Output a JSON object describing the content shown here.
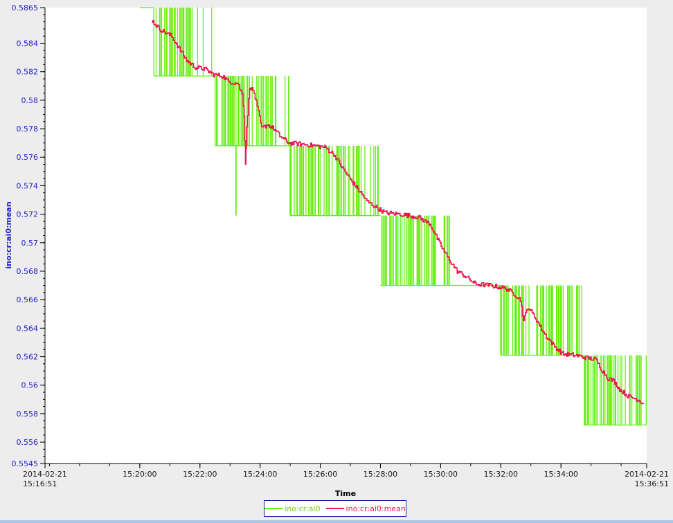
{
  "chart_data": {
    "type": "line",
    "title": "",
    "xlabel": "Time",
    "ylabel": "ino:cr:ai0:mean",
    "ylim": [
      0.5545,
      0.5865
    ],
    "yticks": [
      "0.5545",
      "0.556",
      "0.558",
      "0.56",
      "0.562",
      "0.564",
      "0.566",
      "0.568",
      "0.57",
      "0.572",
      "0.574",
      "0.576",
      "0.578",
      "0.58",
      "0.582",
      "0.584",
      "0.5865"
    ],
    "xrange_minutes": [
      0,
      20
    ],
    "xticks": [
      {
        "t": 0,
        "line1": "2014-02-21",
        "line2": "15:16:51",
        "edge": "start"
      },
      {
        "t": 3.15,
        "line1": "15:20:00"
      },
      {
        "t": 5.15,
        "line1": "15:22:00"
      },
      {
        "t": 7.15,
        "line1": "15:24:00"
      },
      {
        "t": 9.15,
        "line1": "15:26:00"
      },
      {
        "t": 11.15,
        "line1": "15:28:00"
      },
      {
        "t": 13.15,
        "line1": "15:30:00"
      },
      {
        "t": 15.15,
        "line1": "15:32:00"
      },
      {
        "t": 17.15,
        "line1": "15:34:00"
      },
      {
        "t": 20,
        "line1": "2014-02-21",
        "line2": "15:36:51",
        "edge": "end"
      }
    ],
    "series": [
      {
        "name": "ino:cr:ai0",
        "color": "#66ee11",
        "segments": [
          {
            "t0": 3.15,
            "t1": 3.6,
            "low": 0.5865,
            "high": 0.5865,
            "dense": false
          },
          {
            "t0": 3.6,
            "t1": 5.65,
            "low": 0.5817,
            "high": 0.5865,
            "dense": true
          },
          {
            "t0": 5.65,
            "t1": 8.15,
            "low": 0.5768,
            "high": 0.5817,
            "dense": true
          },
          {
            "t0": 8.15,
            "t1": 11.15,
            "low": 0.5719,
            "high": 0.5768,
            "dense": true
          },
          {
            "t0": 11.15,
            "t1": 13.5,
            "low": 0.567,
            "high": 0.5719,
            "dense": true
          },
          {
            "t0": 13.5,
            "t1": 15.15,
            "low": 0.567,
            "high": 0.567,
            "dense": false
          },
          {
            "t0": 15.15,
            "t1": 16.5,
            "low": 0.5621,
            "high": 0.567,
            "dense": true
          },
          {
            "t0": 16.5,
            "t1": 17.9,
            "low": 0.5621,
            "high": 0.567,
            "dense": true
          },
          {
            "t0": 17.9,
            "t1": 20,
            "low": 0.5572,
            "high": 0.5621,
            "dense": true
          }
        ],
        "outliers": [
          {
            "t": 6.35,
            "low": 0.5719,
            "high": 0.5768
          },
          {
            "t": 8.15,
            "low": 0.5719,
            "high": 0.5768
          },
          {
            "t": 9.1,
            "low": 0.5719,
            "high": 0.5768
          },
          {
            "t": 6.0,
            "low": 0.5768,
            "high": 0.5817
          },
          {
            "t": 8.1,
            "low": 0.5768,
            "high": 0.5817
          },
          {
            "t": 12.4,
            "low": 0.567,
            "high": 0.5719
          },
          {
            "t": 15.15,
            "low": 0.5621,
            "high": 0.567
          },
          {
            "t": 18.05,
            "low": 0.5572,
            "high": 0.5621
          }
        ]
      },
      {
        "name": "ino:cr:ai0:mean",
        "color": "#e8194e",
        "points": [
          [
            3.55,
            0.5856
          ],
          [
            3.8,
            0.585
          ],
          [
            4.2,
            0.5845
          ],
          [
            4.5,
            0.5835
          ],
          [
            4.7,
            0.5828
          ],
          [
            5.0,
            0.5823
          ],
          [
            5.3,
            0.5822
          ],
          [
            5.6,
            0.5818
          ],
          [
            5.9,
            0.5817
          ],
          [
            6.1,
            0.5813
          ],
          [
            6.4,
            0.5812
          ],
          [
            6.55,
            0.5804
          ],
          [
            6.62,
            0.579
          ],
          [
            6.66,
            0.5755
          ],
          [
            6.7,
            0.578
          ],
          [
            6.8,
            0.581
          ],
          [
            6.95,
            0.5805
          ],
          [
            7.05,
            0.5795
          ],
          [
            7.2,
            0.578
          ],
          [
            7.4,
            0.5783
          ],
          [
            7.6,
            0.578
          ],
          [
            7.8,
            0.5775
          ],
          [
            8.1,
            0.577
          ],
          [
            8.6,
            0.5769
          ],
          [
            9.0,
            0.5768
          ],
          [
            9.3,
            0.5767
          ],
          [
            9.6,
            0.5762
          ],
          [
            9.9,
            0.5752
          ],
          [
            10.2,
            0.5743
          ],
          [
            10.5,
            0.5735
          ],
          [
            10.7,
            0.5729
          ],
          [
            11.0,
            0.5725
          ],
          [
            11.3,
            0.5721
          ],
          [
            11.8,
            0.572
          ],
          [
            12.4,
            0.5718
          ],
          [
            12.8,
            0.5713
          ],
          [
            13.1,
            0.57
          ],
          [
            13.4,
            0.5689
          ],
          [
            13.7,
            0.568
          ],
          [
            14.0,
            0.5676
          ],
          [
            14.3,
            0.5671
          ],
          [
            14.8,
            0.567
          ],
          [
            15.3,
            0.5668
          ],
          [
            15.6,
            0.5664
          ],
          [
            15.8,
            0.566
          ],
          [
            15.9,
            0.5645
          ],
          [
            16.05,
            0.5655
          ],
          [
            16.3,
            0.5647
          ],
          [
            16.6,
            0.5636
          ],
          [
            16.9,
            0.5628
          ],
          [
            17.2,
            0.5622
          ],
          [
            17.6,
            0.5621
          ],
          [
            18.05,
            0.5619
          ],
          [
            18.3,
            0.5618
          ],
          [
            18.5,
            0.5611
          ],
          [
            18.7,
            0.5605
          ],
          [
            18.9,
            0.5603
          ],
          [
            19.1,
            0.5597
          ],
          [
            19.4,
            0.5592
          ],
          [
            19.7,
            0.559
          ],
          [
            19.9,
            0.5587
          ]
        ]
      }
    ],
    "legend": {
      "placement": "bottom-center",
      "entries": [
        "ino:cr:ai0",
        "ino:cr:ai0:mean"
      ]
    },
    "grid": false
  }
}
